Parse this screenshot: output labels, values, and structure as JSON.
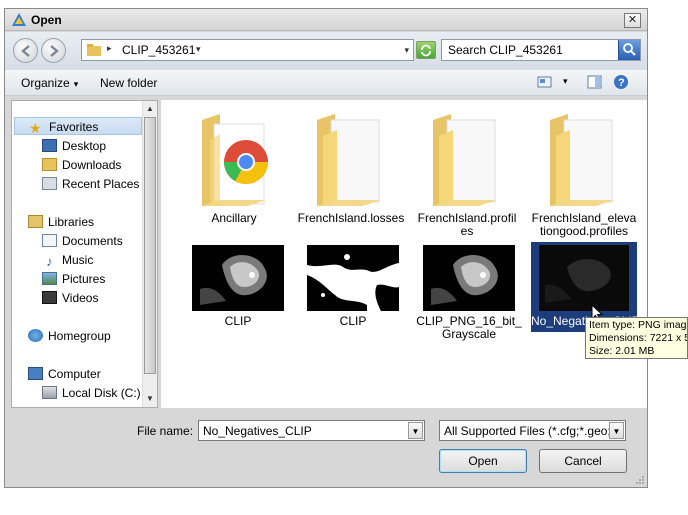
{
  "window": {
    "title": "Open",
    "close_glyph": "✕"
  },
  "address": {
    "crumb": "CLIP_453261"
  },
  "search": {
    "placeholder": "Search CLIP_453261"
  },
  "toolbar": {
    "organize": "Organize",
    "new_folder": "New folder"
  },
  "nav": {
    "favorites": "Favorites",
    "desktop": "Desktop",
    "downloads": "Downloads",
    "recent": "Recent Places",
    "libraries": "Libraries",
    "documents": "Documents",
    "music": "Music",
    "pictures": "Pictures",
    "videos": "Videos",
    "homegroup": "Homegroup",
    "computer": "Computer",
    "local_disk": "Local Disk (C:)"
  },
  "files": [
    {
      "name": "Ancillary",
      "kind": "folder-chrome"
    },
    {
      "name": "FrenchIsland.losses",
      "kind": "folder"
    },
    {
      "name_l1": "FrenchIsland.profil",
      "name_l2": "es",
      "kind": "folder"
    },
    {
      "name_l1": "FrenchIsland_eleva",
      "name_l2": "tiongood.profiles",
      "kind": "folder"
    },
    {
      "name": "CLIP",
      "kind": "image-gray"
    },
    {
      "name": "CLIP",
      "kind": "image-bw"
    },
    {
      "name_l1": "CLIP_PNG_16_bit_",
      "name_l2": "Grayscale",
      "kind": "image-gray"
    },
    {
      "name": "No_Negatives_CLIP",
      "kind": "image-dark",
      "selected": true
    }
  ],
  "tooltip": {
    "line1": "Item type: PNG imag",
    "line2": "Dimensions: 7221 x 5",
    "line3": "Size: 2.01 MB"
  },
  "bottom": {
    "file_name_label": "File name:",
    "file_name_value": "No_Negatives_CLIP",
    "filter": "All Supported Files (*.cfg;*.geo;",
    "open": "Open",
    "cancel": "Cancel"
  },
  "colors": {
    "selection": "#1c3c7b",
    "folder": "#f5d77a",
    "tooltip_bg": "#ffffe1"
  }
}
